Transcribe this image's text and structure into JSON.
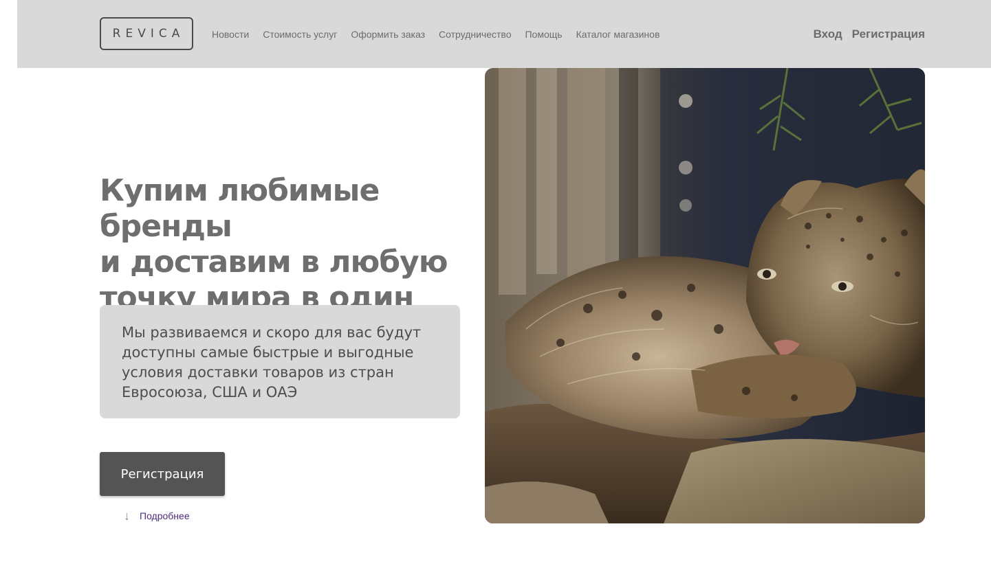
{
  "header": {
    "logo": "REVICA",
    "nav": [
      {
        "label": "Новости"
      },
      {
        "label": "Стоимость услуг"
      },
      {
        "label": "Оформить заказ"
      },
      {
        "label": "Сотрудничество"
      },
      {
        "label": "Помощь"
      },
      {
        "label": "Каталог магазинов"
      }
    ],
    "login_label": "Вход",
    "register_label": "Регистрация"
  },
  "hero": {
    "title_lines": [
      "Купим любимые бренды",
      "и доставим в любую",
      "точку мира в один клик"
    ],
    "info_text": "Мы развиваемся и скоро для вас будут доступны самые быстрые и выгодные условия доставки товаров из стран Евросоюза, США и ОАЭ",
    "register_button": "Регистрация",
    "more_arrow": "↓",
    "more_label": "Подробнее"
  },
  "colors": {
    "header_bg": "#d9d9d9",
    "text": "#6e6e6e",
    "button_bg": "#545454",
    "link": "#4b2c7a"
  },
  "icons": {
    "more_arrow": "arrow-down-icon"
  }
}
